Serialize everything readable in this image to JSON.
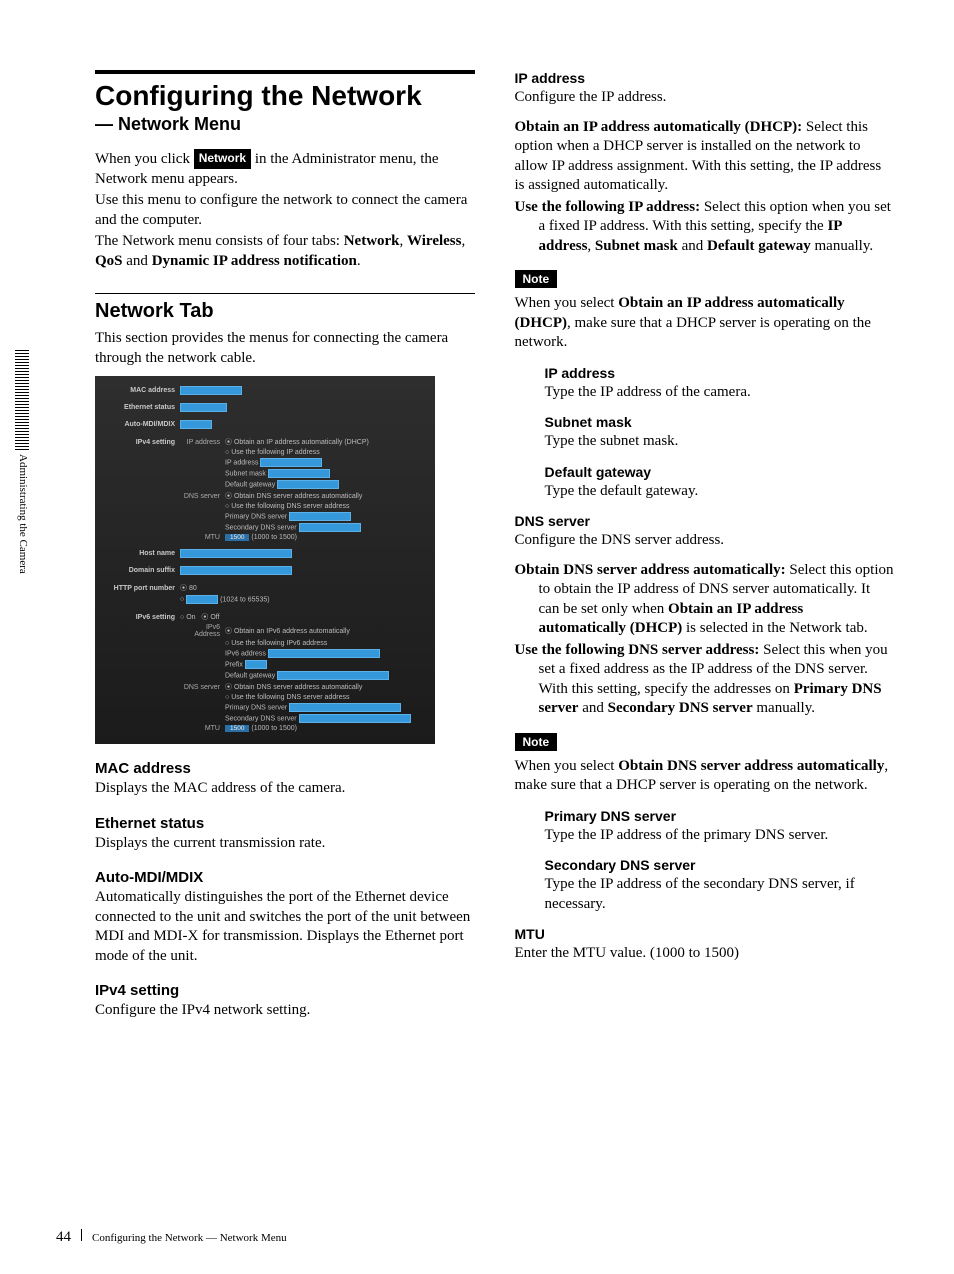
{
  "side_tab": "Administrating the Camera",
  "title": "Configuring the Network",
  "subtitle": "— Network Menu",
  "intro": {
    "p1a": "When you click ",
    "p1btn": "Network",
    "p1b": " in the Administrator menu, the Network menu appears.",
    "p2": "Use this menu to configure the network to connect the camera and the computer.",
    "p3a": "The Network menu consists of four tabs: ",
    "p3b": "Network",
    "p3c": ", ",
    "p3d": "Wireless",
    "p3e": ", ",
    "p3f": "QoS",
    "p3g": " and ",
    "p3h": "Dynamic IP address notification",
    "p3i": "."
  },
  "network_tab": {
    "heading": "Network Tab",
    "desc": "This section provides the menus for connecting the camera through the network cable."
  },
  "shot": {
    "mac": "MAC address",
    "eth": "Ethernet status",
    "auto": "Auto-MDI/MDIX",
    "ipv4": "IPv4 setting",
    "ipaddr_l": "IP address",
    "dhcp": "Obtain an IP address automatically (DHCP)",
    "usef": "Use the following IP address",
    "ip": "IP address",
    "sub": "Subnet mask",
    "gw": "Default gateway",
    "dns_l": "DNS server",
    "dnsauto": "Obtain DNS server address automatically",
    "dnsuse": "Use the following DNS server address",
    "pdns": "Primary DNS server",
    "sdns": "Secondary DNS server",
    "mtu": "MTU",
    "mtuv": "1500",
    "mtur": "(1000 to 1500)",
    "host": "Host name",
    "domain": "Domain suffix",
    "http": "HTTP port number",
    "http80": "80",
    "httprange": "(1024 to 65535)",
    "ipv6": "IPv6 setting",
    "on": "On",
    "off": "Off",
    "ipv6addr_l": "IPv6 Address",
    "ipv6auto": "Obtain an IPv6 address automatically",
    "ipv6use": "Use the following IPv6 address",
    "ipv6addr": "IPv6 address",
    "prefix": "Prefix",
    "ipv6gw": "Default gateway",
    "ipv6dnsauto": "Obtain DNS server address automatically",
    "ipv6dnsuse": "Use the following DNS server address"
  },
  "left_sections": {
    "mac_h": "MAC address",
    "mac_p": "Displays the MAC address of the camera.",
    "eth_h": "Ethernet status",
    "eth_p": "Displays the current transmission rate.",
    "auto_h": "Auto-MDI/MDIX",
    "auto_p": "Automatically distinguishes the port of the Ethernet device connected to the unit and switches the port of the unit between MDI and MDI-X for transmission. Displays the Ethernet port mode of the unit.",
    "ipv4_h": "IPv4 setting",
    "ipv4_p": "Configure the IPv4 network setting."
  },
  "right": {
    "ip_h": "IP address",
    "ip_p": "Configure the IP address.",
    "dhcp_lead": "Obtain an IP address automatically (DHCP): ",
    "dhcp_body": "Select this option when a DHCP server is installed on the network to allow IP address assignment. With this setting, the IP address is assigned automatically.",
    "usef_lead": "Use the following IP address: ",
    "usef_a": "Select this option when you set a fixed IP address. With this setting, specify the ",
    "usef_b": "IP address",
    "usef_c": ", ",
    "usef_d": "Subnet mask",
    "usef_e": " and ",
    "usef_f": "Default gateway",
    "usef_g": " manually.",
    "note1_label": "Note",
    "note1_a": "When you select ",
    "note1_b": "Obtain an IP address automatically (DHCP)",
    "note1_c": ", make sure that a DHCP server is operating on the network.",
    "ip_sub_h": "IP address",
    "ip_sub_p": "Type the IP address of the camera.",
    "subnet_h": "Subnet mask",
    "subnet_p": "Type the subnet mask.",
    "gw_h": "Default gateway",
    "gw_p": "Type the default gateway.",
    "dns_h": "DNS server",
    "dns_p": "Configure the DNS server address.",
    "dnsauto_lead": "Obtain DNS server address automatically: ",
    "dnsauto_a": "Select this option to obtain the IP address of DNS server automatically. It can be set only when ",
    "dnsauto_b": "Obtain an IP address automatically (DHCP)",
    "dnsauto_c": " is selected in the Network tab.",
    "dnsuse_lead": "Use the following DNS server address: ",
    "dnsuse_a": "Select this when you set a fixed address as the IP address of the DNS server. With this setting, specify the addresses on ",
    "dnsuse_b": "Primary DNS server",
    "dnsuse_c": " and ",
    "dnsuse_d": "Secondary DNS server",
    "dnsuse_e": " manually.",
    "note2_label": "Note",
    "note2_a": "When you select ",
    "note2_b": "Obtain DNS server address automatically",
    "note2_c": ", make sure that a DHCP server is operating on the network.",
    "pdns_h": "Primary DNS server",
    "pdns_p": "Type the IP address of the primary DNS server.",
    "sdns_h": "Secondary DNS server",
    "sdns_p": "Type the IP address of the secondary DNS server, if necessary.",
    "mtu_h": "MTU",
    "mtu_p": "Enter the MTU value. (1000 to 1500)"
  },
  "footer": {
    "page": "44",
    "text": "Configuring the Network — Network Menu"
  }
}
